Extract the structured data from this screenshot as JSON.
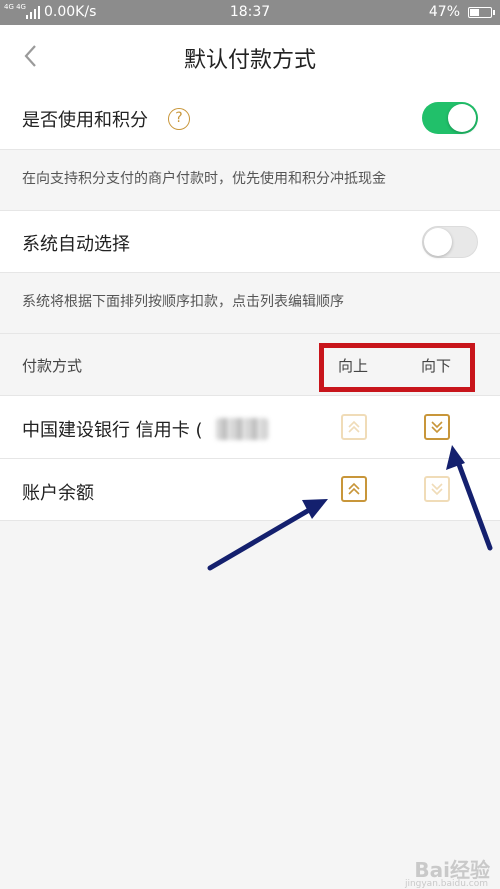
{
  "status_bar": {
    "network": "4G 4G",
    "speed": "0.00K/s",
    "time": "18:37",
    "battery": "47%",
    "battery_level": 0.47
  },
  "nav": {
    "title": "默认付款方式",
    "back_icon": "chevron-left-icon"
  },
  "points": {
    "label": "是否使用和积分",
    "help_icon": "question-circle-icon",
    "help_glyph": "?",
    "enabled": true,
    "hint": "在向支持积分支付的商户付款时，优先使用和积分冲抵现金"
  },
  "auto_select": {
    "label": "系统自动选择",
    "enabled": false,
    "hint": "系统将根据下面排列按顺序扣款，点击列表编辑顺序"
  },
  "payment_list": {
    "header": "付款方式",
    "col_up": "向上",
    "col_down": "向下",
    "items": [
      {
        "name": "中国建设银行 信用卡 (",
        "up_enabled": false,
        "down_enabled": true
      },
      {
        "name": "账户余额",
        "up_enabled": true,
        "down_enabled": false
      }
    ]
  },
  "colors": {
    "accent": "#c8963a",
    "toggle_on": "#21c06a",
    "highlight_box": "#c8151b",
    "annotation_arrow": "#14206e"
  },
  "watermark": {
    "text": "Bai经验",
    "sub": "jingyan.baidu.com"
  }
}
